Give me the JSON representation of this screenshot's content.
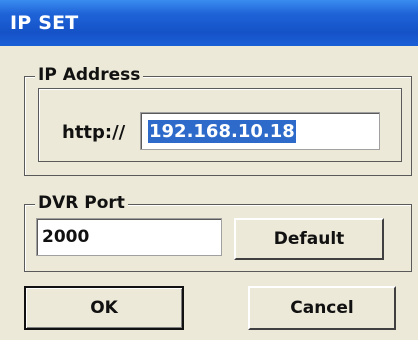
{
  "window": {
    "title": "IP SET"
  },
  "ip_group": {
    "legend": "IP Address",
    "prefix_label": "http://",
    "ip_value": "192.168.10.18"
  },
  "port_group": {
    "legend": "DVR Port",
    "port_value": "2000",
    "default_label": "Default"
  },
  "buttons": {
    "ok_label": "OK",
    "cancel_label": "Cancel"
  },
  "colors": {
    "titlebar": "#1552c8",
    "selection": "#2d6ac9",
    "dialog_bg": "#ece9d8"
  }
}
